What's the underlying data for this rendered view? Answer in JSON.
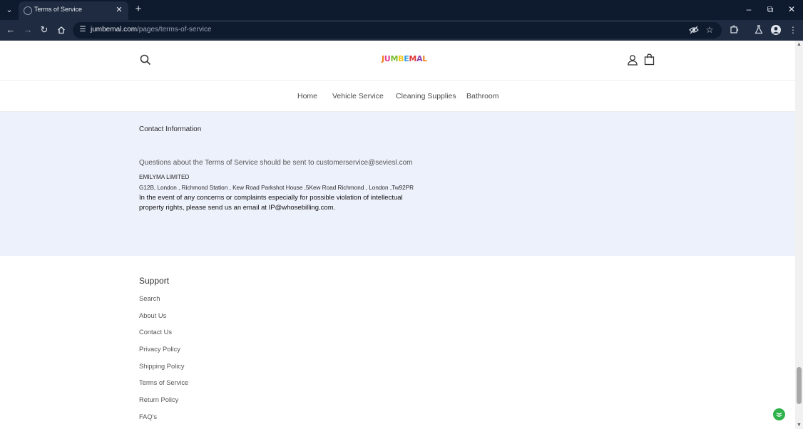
{
  "browser": {
    "tab_title": "Terms of Service",
    "url_host": "jumbemal.com",
    "url_path": "/pages/terms-of-service",
    "icons": {
      "tab_list": "chevron-down-icon",
      "favicon": "globe-icon",
      "close_tab": "close-icon",
      "new_tab": "plus-icon",
      "minimize": "minimize-icon",
      "restore": "restore-icon",
      "close_window": "close-icon",
      "back": "arrow-left-icon",
      "forward": "arrow-right-icon",
      "reload": "reload-icon",
      "home": "home-icon",
      "site_info": "tune-icon",
      "eye_off": "eye-off-icon",
      "bookmark": "star-icon",
      "extensions": "puzzle-icon",
      "labs": "flask-icon",
      "profile": "profile-icon",
      "menu": "kebab-menu-icon"
    }
  },
  "header": {
    "logo_text": "JUMBEMAL",
    "icons": {
      "search": "search-icon",
      "account": "user-icon",
      "cart": "shopping-bag-icon"
    }
  },
  "nav": {
    "items": [
      {
        "label": "Home"
      },
      {
        "label": "Vehicle Service"
      },
      {
        "label": "Cleaning Supplies"
      },
      {
        "label": "Bathroom"
      }
    ]
  },
  "contact": {
    "heading": "Contact Information",
    "question": "Questions about the Terms of Service should be sent to customerservice@seviesl.com",
    "company": "EMILYMA LIMITED",
    "address": "G12B, London , Richmond Station , Kew Road Parkshot House ,5Kew Road Richmond , London ,Tw92PR",
    "ip_notice": "In the event of any concerns or complaints especially for possible violation of intellectual property rights, please send us an email at IP@whosebilling.com."
  },
  "footer": {
    "heading": "Support",
    "links": [
      {
        "label": "Search"
      },
      {
        "label": "About Us"
      },
      {
        "label": "Contact Us"
      },
      {
        "label": "Privacy Policy"
      },
      {
        "label": "Shipping Policy"
      },
      {
        "label": "Terms of Service"
      },
      {
        "label": "Return Policy"
      },
      {
        "label": "FAQ's"
      }
    ]
  },
  "colors": {
    "chrome_dark": "#0e1a2e",
    "chrome_toolbar": "#1e2b40",
    "contact_bg": "#edf1fb",
    "chat_badge": "#2fb24c"
  }
}
